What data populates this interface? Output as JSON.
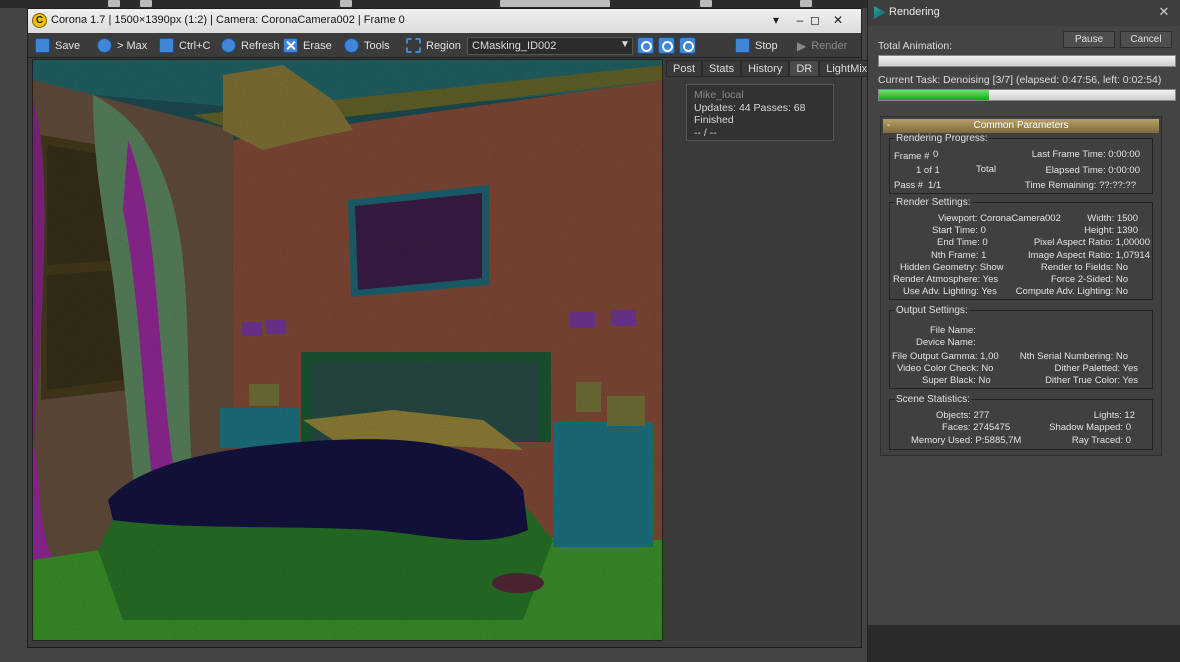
{
  "vfb": {
    "title": "Corona 1.7 | 1500×1390px (1:2) | Camera: CoronaCamera002 | Frame 0",
    "logo": "C",
    "window_controls": [
      "▾",
      "–",
      "◻",
      "✕"
    ],
    "toolbar": {
      "save": "Save",
      "to_max": "> Max",
      "copy": "Ctrl+C",
      "refresh": "Refresh",
      "erase": "Erase",
      "tools": "Tools",
      "region": "Region",
      "pass": "CMasking_ID002",
      "stop": "Stop",
      "render": "Render"
    },
    "tabs": [
      "Post",
      "Stats",
      "History",
      "DR",
      "LightMix"
    ],
    "dr": {
      "node": "Mike_local",
      "updates": "Updates: 44  Passes: 68",
      "status": "Finished",
      "extra": "-- / --"
    }
  },
  "rendering": {
    "title": "Rendering",
    "close": "✕",
    "total_animation_label": "Total Animation:",
    "pause": "Pause",
    "cancel": "Cancel",
    "current_task_label": "Current Task:",
    "current_task": "Denoising [3/7] (elapsed: 0:47:56, left: 0:02:54)",
    "total_progress": 0.0,
    "task_progress": 0.37,
    "common_parameters": "Common Parameters",
    "progress": {
      "title": "Rendering Progress:",
      "frame_label": "Frame #",
      "frame": "0",
      "of": "1 of 1",
      "total": "Total",
      "pass_label": "Pass #",
      "pass": "1/1",
      "last_frame_time": "Last Frame Time:  0:00:00",
      "elapsed_time": "Elapsed Time:  0:00:00",
      "time_remaining": "Time Remaining:  ??:??:??"
    },
    "render_settings": {
      "title": "Render Settings:",
      "left": [
        "Viewport:  CoronaCamera002",
        "Start Time:  0",
        "End Time:  0",
        "Nth Frame:  1",
        "Hidden Geometry:  Show",
        "Render Atmosphere:  Yes",
        "Use Adv. Lighting:  Yes"
      ],
      "right": [
        "Width:  1500",
        "Height:  1390",
        "Pixel Aspect Ratio:  1,00000",
        "Image Aspect Ratio:  1,07914",
        "Render to Fields:  No",
        "Force 2-Sided:  No",
        "Compute Adv. Lighting:  No"
      ]
    },
    "output_settings": {
      "title": "Output Settings:",
      "left": [
        "File Name:",
        "Device Name:",
        "File Output Gamma:  1,00",
        "Video Color Check:  No",
        "Super Black:  No"
      ],
      "right": [
        "Nth Serial Numbering:  No",
        "Dither Paletted:  Yes",
        "Dither True Color:  Yes"
      ]
    },
    "scene_statistics": {
      "title": "Scene Statistics:",
      "left": [
        "Objects:  277",
        "Faces:  2745475",
        "Memory Used:  P:5885,7M"
      ],
      "right": [
        "Lights:  12",
        "Shadow Mapped:  0",
        "Ray Traced:  0"
      ]
    }
  },
  "colors": {
    "accent": "#3d86d8",
    "progress_green": "#14a614",
    "panel_header": "#9a8652"
  }
}
